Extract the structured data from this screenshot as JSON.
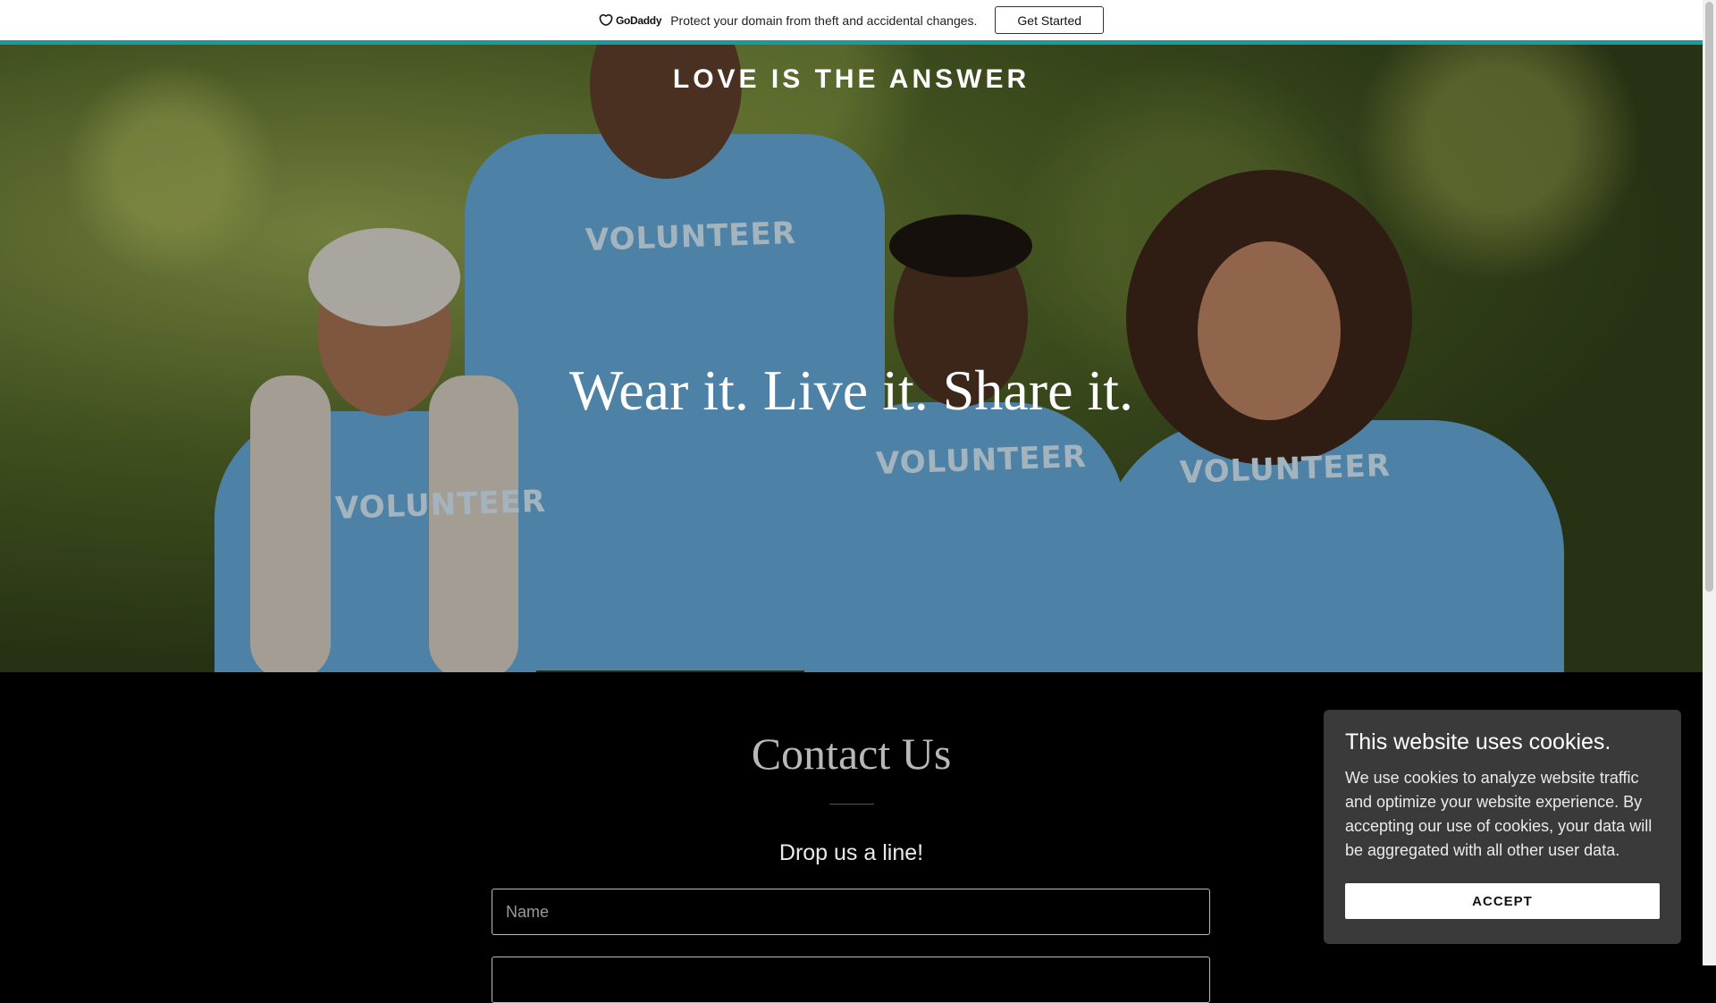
{
  "promo": {
    "logo_text": "GoDaddy",
    "message": "Protect your domain from theft and accidental changes.",
    "button_label": "Get Started"
  },
  "hero": {
    "site_title": "LOVE IS THE ANSWER",
    "tagline": "Wear it. Live it. Share it.",
    "shirt_text": "VOLUNTEER"
  },
  "contact": {
    "title": "Contact Us",
    "subtitle": "Drop us a line!",
    "name_placeholder": "Name"
  },
  "cookie": {
    "title": "This website uses cookies.",
    "body": "We use cookies to analyze website traffic and optimize your website experience. By accepting our use of cookies, your data will be aggregated with all other user data.",
    "accept_label": "ACCEPT"
  },
  "colors": {
    "promo_border": "#1b9c9c",
    "shirt_blue": "#5f9fcb",
    "cookie_bg": "#3a3a3a"
  }
}
